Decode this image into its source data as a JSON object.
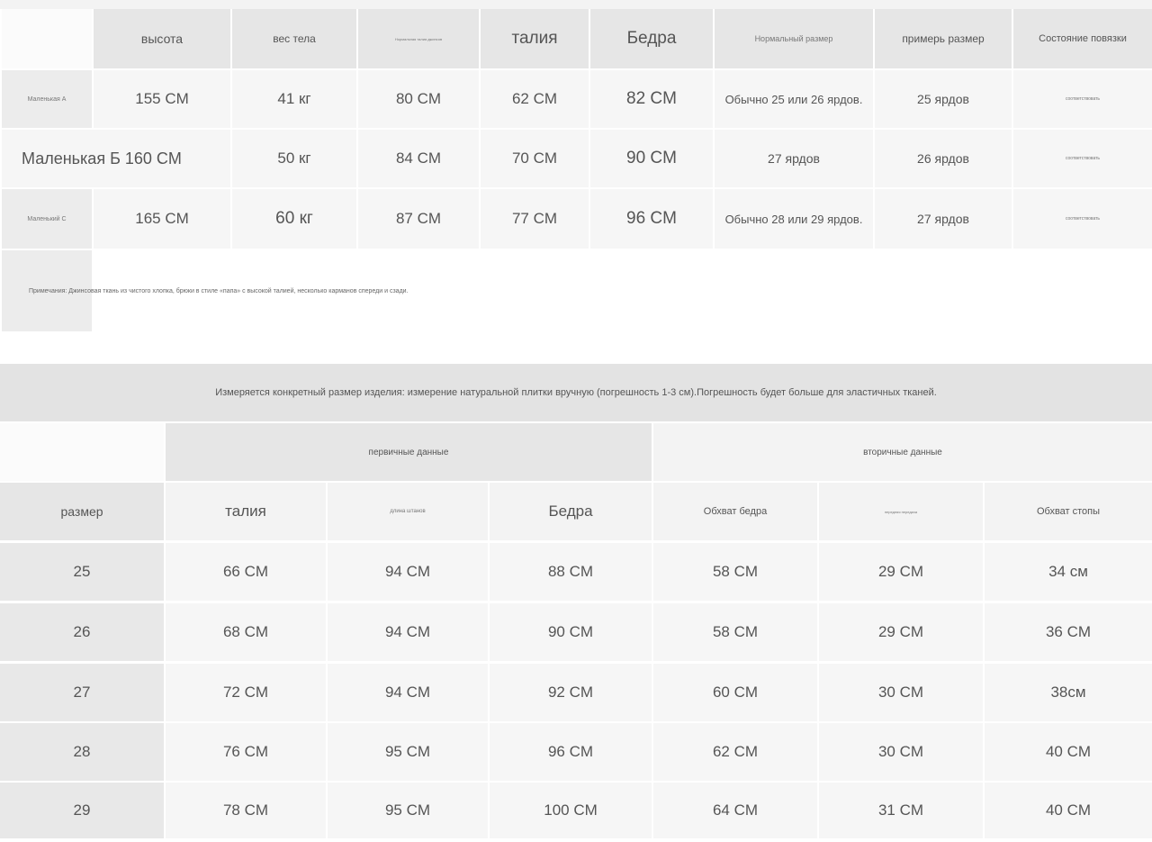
{
  "table1": {
    "headers": [
      "высота",
      "вес тела",
      "Нормальная талия джинсов",
      "талия",
      "Бедра",
      "Нормальный размер",
      "примерь размер",
      "Состояние повязки"
    ],
    "rows": [
      {
        "label": "Маленькая А",
        "cells": [
          "155 CM",
          "41 кг",
          "80 CM",
          "62 CM",
          "82 CM",
          "Обычно 25 или 26 ярдов.",
          "25 ярдов",
          "соответствовать"
        ]
      },
      {
        "label": "Маленькая Б 160 CM",
        "cells": [
          "50 кг",
          "84 CM",
          "70 CM",
          "90 CM",
          "27 ярдов",
          "26 ярдов",
          "соответствовать"
        ]
      },
      {
        "label": "Маленький С",
        "cells": [
          "165 CM",
          "60 кг",
          "87 CM",
          "77 CM",
          "96 CM",
          "Обычно 28 или 29 ярдов.",
          "27 ярдов",
          "соответствовать"
        ]
      }
    ],
    "notes": "Примечания: Джинсовая ткань из чистого хлопка, брюки в стиле «папа» с высокой талией, несколько карманов спереди и сзади."
  },
  "table2": {
    "banner": "Измеряется конкретный размер изделия: измерение натуральной плитки вручную (погрешность 1-3 см).Погрешность будет больше для эластичных тканей.",
    "group_primary": "первичные данные",
    "group_secondary": "вторичные данные",
    "headers": [
      "размер",
      "талия",
      "длина штанов",
      "Бедра",
      "Обхват бедра",
      "передняя передача",
      "Обхват стопы"
    ],
    "rows": [
      [
        "25",
        "66 CM",
        "94 CM",
        "88 CM",
        "58 CM",
        "29 CM",
        "34 см"
      ],
      [
        "26",
        "68 CM",
        "94 CM",
        "90 CM",
        "58 CM",
        "29 CM",
        "36 CM"
      ],
      [
        "27",
        "72 CM",
        "94 CM",
        "92 CM",
        "60 CM",
        "30 CM",
        "38см"
      ],
      [
        "28",
        "76 CM",
        "95 CM",
        "96 CM",
        "62 CM",
        "30 CM",
        "40 CM"
      ],
      [
        "29",
        "78 CM",
        "95 CM",
        "100 CM",
        "64 CM",
        "31 CM",
        "40 CM"
      ]
    ]
  }
}
